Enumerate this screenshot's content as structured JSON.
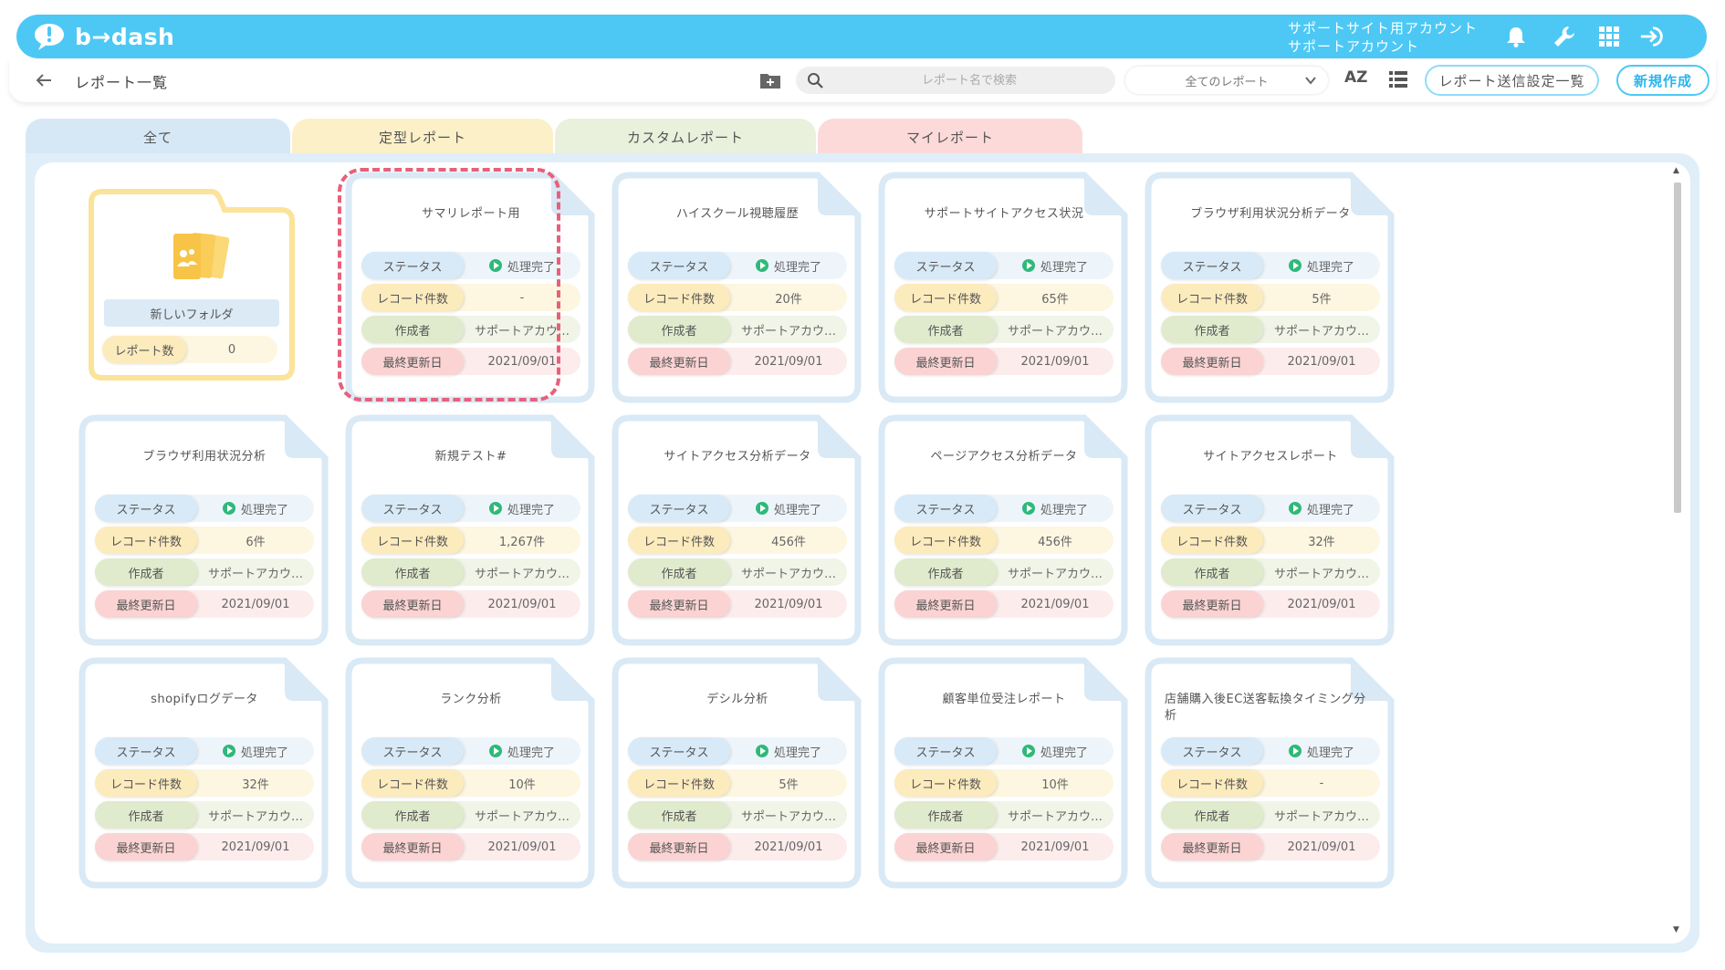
{
  "brand": {
    "logo_text": "b→dash"
  },
  "account": {
    "line1": "サポートサイト用アカウント",
    "line2": "サポートアカウント"
  },
  "header": {
    "title": "レポート一覧",
    "search_placeholder": "レポート名で検索",
    "filter_selected": "全てのレポート",
    "sort_label": "AZ",
    "send_settings_label": "レポート送信設定一覧",
    "new_label": "新規作成"
  },
  "tabs": [
    {
      "label": "全て",
      "color": "#d6e8f6"
    },
    {
      "label": "定型レポート",
      "color": "#fcf0c8"
    },
    {
      "label": "カスタムレポート",
      "color": "#e9f0dc"
    },
    {
      "label": "マイレポート",
      "color": "#fcdada"
    }
  ],
  "field_labels": {
    "status": "ステータス",
    "record": "レコード件数",
    "author": "作成者",
    "date": "最終更新日",
    "report_count": "レポート数"
  },
  "folder": {
    "name": "新しいフォルダ",
    "report_count": "0"
  },
  "reports": [
    {
      "title": "サマリレポート用",
      "status": "処理完了",
      "records": "-",
      "author": "サポートアカウ…",
      "date": "2021/09/01",
      "highlighted": true
    },
    {
      "title": "ハイスクール視聴履歴",
      "status": "処理完了",
      "records": "20件",
      "author": "サポートアカウ…",
      "date": "2021/09/01"
    },
    {
      "title": "サポートサイトアクセス状況",
      "status": "処理完了",
      "records": "65件",
      "author": "サポートアカウ…",
      "date": "2021/09/01"
    },
    {
      "title": "ブラウザ利用状況分析データ",
      "status": "処理完了",
      "records": "5件",
      "author": "サポートアカウ…",
      "date": "2021/09/01"
    },
    {
      "title": "ブラウザ利用状況分析",
      "status": "処理完了",
      "records": "6件",
      "author": "サポートアカウ…",
      "date": "2021/09/01"
    },
    {
      "title": "新規テスト#",
      "status": "処理完了",
      "records": "1,267件",
      "author": "サポートアカウ…",
      "date": "2021/09/01"
    },
    {
      "title": "サイトアクセス分析データ",
      "status": "処理完了",
      "records": "456件",
      "author": "サポートアカウ…",
      "date": "2021/09/01"
    },
    {
      "title": "ページアクセス分析データ",
      "status": "処理完了",
      "records": "456件",
      "author": "サポートアカウ…",
      "date": "2021/09/01"
    },
    {
      "title": "サイトアクセスレポート",
      "status": "処理完了",
      "records": "32件",
      "author": "サポートアカウ…",
      "date": "2021/09/01"
    },
    {
      "title": "shopifyログデータ",
      "status": "処理完了",
      "records": "32件",
      "author": "サポートアカウ…",
      "date": "2021/09/01"
    },
    {
      "title": "ランク分析",
      "status": "処理完了",
      "records": "10件",
      "author": "サポートアカウ…",
      "date": "2021/09/01"
    },
    {
      "title": "デシル分析",
      "status": "処理完了",
      "records": "5件",
      "author": "サポートアカウ…",
      "date": "2021/09/01"
    },
    {
      "title": "顧客単位受注レポート",
      "status": "処理完了",
      "records": "10件",
      "author": "サポートアカウ…",
      "date": "2021/09/01"
    },
    {
      "title": "店舗購入後EC送客転換タイミング分析",
      "status": "処理完了",
      "records": "-",
      "author": "サポートアカウ…",
      "date": "2021/09/01"
    }
  ],
  "colors": {
    "accent": "#4dc8f5",
    "status_ok": "#2fb979",
    "highlight": "#e8607a"
  }
}
